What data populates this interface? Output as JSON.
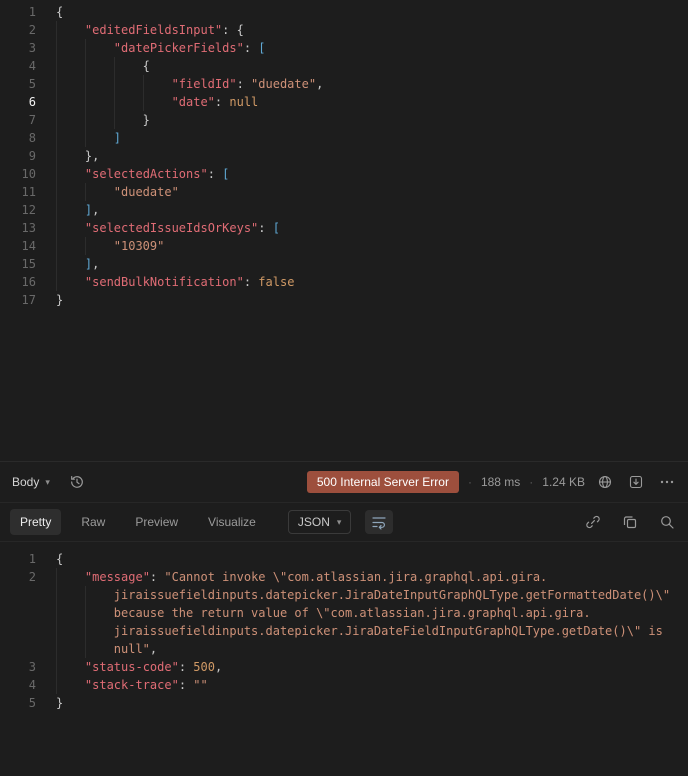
{
  "colors": {
    "key": "#e06c75",
    "string": "#ce9178",
    "literal": "#d19a66",
    "brace": "#c9c9c9",
    "bracket": "#5fa8d3",
    "punct": "#c9c9c9",
    "status_bg": "#9d4f3d"
  },
  "request_editor": {
    "lines": [
      {
        "n": 1,
        "indent": 0,
        "tokens": [
          {
            "t": "{",
            "c": "brace"
          }
        ]
      },
      {
        "n": 2,
        "indent": 1,
        "tokens": [
          {
            "t": "\"editedFieldsInput\"",
            "c": "key"
          },
          {
            "t": ": ",
            "c": "punct"
          },
          {
            "t": "{",
            "c": "brace"
          }
        ]
      },
      {
        "n": 3,
        "indent": 2,
        "tokens": [
          {
            "t": "\"datePickerFields\"",
            "c": "key"
          },
          {
            "t": ": ",
            "c": "punct"
          },
          {
            "t": "[",
            "c": "bracket"
          }
        ]
      },
      {
        "n": 4,
        "indent": 3,
        "tokens": [
          {
            "t": "{",
            "c": "brace"
          }
        ]
      },
      {
        "n": 5,
        "indent": 4,
        "tokens": [
          {
            "t": "\"fieldId\"",
            "c": "key"
          },
          {
            "t": ": ",
            "c": "punct"
          },
          {
            "t": "\"duedate\"",
            "c": "string"
          },
          {
            "t": ",",
            "c": "punct"
          }
        ]
      },
      {
        "n": 6,
        "indent": 4,
        "active": true,
        "tokens": [
          {
            "t": "\"date\"",
            "c": "key"
          },
          {
            "t": ": ",
            "c": "punct"
          },
          {
            "t": "null",
            "c": "literal"
          }
        ]
      },
      {
        "n": 7,
        "indent": 3,
        "tokens": [
          {
            "t": "}",
            "c": "brace"
          }
        ]
      },
      {
        "n": 8,
        "indent": 2,
        "tokens": [
          {
            "t": "]",
            "c": "bracket"
          }
        ]
      },
      {
        "n": 9,
        "indent": 1,
        "tokens": [
          {
            "t": "}",
            "c": "brace"
          },
          {
            "t": ",",
            "c": "punct"
          }
        ]
      },
      {
        "n": 10,
        "indent": 1,
        "tokens": [
          {
            "t": "\"selectedActions\"",
            "c": "key"
          },
          {
            "t": ": ",
            "c": "punct"
          },
          {
            "t": "[",
            "c": "bracket"
          }
        ]
      },
      {
        "n": 11,
        "indent": 2,
        "tokens": [
          {
            "t": "\"duedate\"",
            "c": "string"
          }
        ]
      },
      {
        "n": 12,
        "indent": 1,
        "tokens": [
          {
            "t": "]",
            "c": "bracket"
          },
          {
            "t": ",",
            "c": "punct"
          }
        ]
      },
      {
        "n": 13,
        "indent": 1,
        "tokens": [
          {
            "t": "\"selectedIssueIdsOrKeys\"",
            "c": "key"
          },
          {
            "t": ": ",
            "c": "punct"
          },
          {
            "t": "[",
            "c": "bracket"
          }
        ]
      },
      {
        "n": 14,
        "indent": 2,
        "tokens": [
          {
            "t": "\"10309\"",
            "c": "string"
          }
        ]
      },
      {
        "n": 15,
        "indent": 1,
        "tokens": [
          {
            "t": "]",
            "c": "bracket"
          },
          {
            "t": ",",
            "c": "punct"
          }
        ]
      },
      {
        "n": 16,
        "indent": 1,
        "tokens": [
          {
            "t": "\"sendBulkNotification\"",
            "c": "key"
          },
          {
            "t": ": ",
            "c": "punct"
          },
          {
            "t": "false",
            "c": "literal"
          }
        ]
      },
      {
        "n": 17,
        "indent": 0,
        "tokens": [
          {
            "t": "}",
            "c": "brace"
          }
        ]
      }
    ]
  },
  "response_meta": {
    "body_label": "Body",
    "status": "500 Internal Server Error",
    "time": "188 ms",
    "size": "1.24 KB",
    "separator": "·"
  },
  "response_toolbar": {
    "tabs": [
      {
        "label": "Pretty",
        "active": true
      },
      {
        "label": "Raw",
        "active": false
      },
      {
        "label": "Preview",
        "active": false
      },
      {
        "label": "Visualize",
        "active": false
      }
    ],
    "format": "JSON"
  },
  "response_body": {
    "lines": [
      {
        "n": 1,
        "indent": 0,
        "tokens": [
          {
            "t": "{",
            "c": "brace"
          }
        ]
      },
      {
        "n": 2,
        "indent": 1,
        "tokens": [
          {
            "t": "\"message\"",
            "c": "key"
          },
          {
            "t": ": ",
            "c": "punct"
          },
          {
            "t": "\"Cannot invoke \\\"com.atlassian.jira.graphql.api.gira.",
            "c": "string"
          }
        ]
      },
      {
        "n": null,
        "indent": 2,
        "tokens": [
          {
            "t": "jiraissuefieldinputs.datepicker.JiraDateInputGraphQLType.getFormattedDate()\\\"",
            "c": "string"
          }
        ]
      },
      {
        "n": null,
        "indent": 2,
        "tokens": [
          {
            "t": "because the return value of \\\"com.atlassian.jira.graphql.api.gira.",
            "c": "string"
          }
        ]
      },
      {
        "n": null,
        "indent": 2,
        "tokens": [
          {
            "t": "jiraissuefieldinputs.datepicker.JiraDateFieldInputGraphQLType.getDate()\\\" is",
            "c": "string"
          }
        ]
      },
      {
        "n": null,
        "indent": 2,
        "tokens": [
          {
            "t": "null\"",
            "c": "string"
          },
          {
            "t": ",",
            "c": "punct"
          }
        ]
      },
      {
        "n": 3,
        "indent": 1,
        "tokens": [
          {
            "t": "\"status-code\"",
            "c": "key"
          },
          {
            "t": ": ",
            "c": "punct"
          },
          {
            "t": "500",
            "c": "literal"
          },
          {
            "t": ",",
            "c": "punct"
          }
        ]
      },
      {
        "n": 4,
        "indent": 1,
        "tokens": [
          {
            "t": "\"stack-trace\"",
            "c": "key"
          },
          {
            "t": ": ",
            "c": "punct"
          },
          {
            "t": "\"\"",
            "c": "string"
          }
        ]
      },
      {
        "n": 5,
        "indent": 0,
        "tokens": [
          {
            "t": "}",
            "c": "brace"
          }
        ]
      }
    ]
  }
}
